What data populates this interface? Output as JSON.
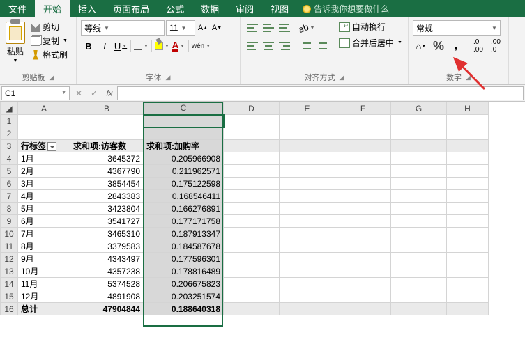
{
  "menu": {
    "file": "文件",
    "home": "开始",
    "insert": "插入",
    "layout": "页面布局",
    "formulas": "公式",
    "data": "数据",
    "review": "审阅",
    "view": "视图",
    "tell_me": "告诉我你想要做什么"
  },
  "ribbon": {
    "clipboard": {
      "paste": "粘贴",
      "cut": "剪切",
      "copy": "复制",
      "format_painter": "格式刷",
      "group_label": "剪贴板"
    },
    "font": {
      "font_name": "等线",
      "font_size": "11",
      "bold": "B",
      "italic": "I",
      "underline": "U",
      "phonetic": "wén",
      "font_letter": "A",
      "group_label": "字体"
    },
    "align": {
      "wrap": "自动换行",
      "merge": "合并后居中",
      "group_label": "对齐方式"
    },
    "number": {
      "format_name": "常规",
      "percent": "%",
      "comma": ",",
      "group_label": "数字"
    }
  },
  "namebox": "C1",
  "sheet": {
    "col_headers": [
      "A",
      "B",
      "C",
      "D",
      "E",
      "F",
      "G",
      "H"
    ],
    "header": {
      "col_a": "行标签",
      "col_b": "求和项:访客数",
      "col_c": "求和项:加购率"
    },
    "rows": [
      {
        "label": "1月",
        "b": "3645372",
        "c": "0.205966908"
      },
      {
        "label": "2月",
        "b": "4367790",
        "c": "0.211962571"
      },
      {
        "label": "3月",
        "b": "3854454",
        "c": "0.175122598"
      },
      {
        "label": "4月",
        "b": "2843383",
        "c": "0.168546411"
      },
      {
        "label": "5月",
        "b": "3423804",
        "c": "0.166276891"
      },
      {
        "label": "6月",
        "b": "3541727",
        "c": "0.177171758"
      },
      {
        "label": "7月",
        "b": "3465310",
        "c": "0.187913347"
      },
      {
        "label": "8月",
        "b": "3379583",
        "c": "0.184587678"
      },
      {
        "label": "9月",
        "b": "4343497",
        "c": "0.177596301"
      },
      {
        "label": "10月",
        "b": "4357238",
        "c": "0.178816489"
      },
      {
        "label": "11月",
        "b": "5374528",
        "c": "0.206675823"
      },
      {
        "label": "12月",
        "b": "4891908",
        "c": "0.203251574"
      }
    ],
    "total": {
      "label": "总计",
      "b": "47904844",
      "c": "0.188640318"
    }
  },
  "chart_data": {
    "type": "table",
    "title": "",
    "columns": [
      "行标签",
      "求和项:访客数",
      "求和项:加购率"
    ],
    "rows": [
      [
        "1月",
        3645372,
        0.205966908
      ],
      [
        "2月",
        4367790,
        0.211962571
      ],
      [
        "3月",
        3854454,
        0.175122598
      ],
      [
        "4月",
        2843383,
        0.168546411
      ],
      [
        "5月",
        3423804,
        0.166276891
      ],
      [
        "6月",
        3541727,
        0.177171758
      ],
      [
        "7月",
        3465310,
        0.187913347
      ],
      [
        "8月",
        3379583,
        0.184587678
      ],
      [
        "9月",
        4343497,
        0.177596301
      ],
      [
        "10月",
        4357238,
        0.178816489
      ],
      [
        "11月",
        5374528,
        0.206675823
      ],
      [
        "12月",
        4891908,
        0.203251574
      ],
      [
        "总计",
        47904844,
        0.188640318
      ]
    ]
  }
}
